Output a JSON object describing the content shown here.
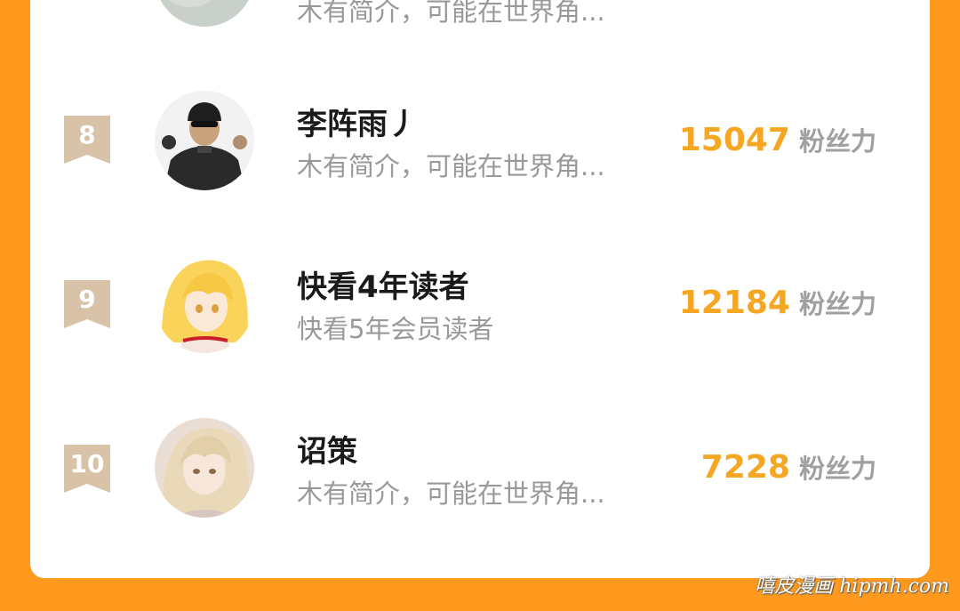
{
  "ranking": {
    "partial_row": {
      "desc": "木有简介，可能在世界角..."
    },
    "rows": [
      {
        "rank": "8",
        "name": "李阵雨丿",
        "desc": "木有简介，可能在世界角...",
        "score": "15047",
        "unit": "粉丝力",
        "avatar_icon": "soldier-avatar-icon"
      },
      {
        "rank": "9",
        "name": "快看4年读者",
        "desc": "快看5年会员读者",
        "score": "12184",
        "unit": "粉丝力",
        "avatar_icon": "anime-girl-blonde-avatar-icon"
      },
      {
        "rank": "10",
        "name": "诏策",
        "desc": "木有简介，可能在世界角...",
        "score": "7228",
        "unit": "粉丝力",
        "avatar_icon": "anime-girl-light-hair-avatar-icon"
      }
    ]
  },
  "watermark": "嘻皮漫画 hipmh.com",
  "colors": {
    "background": "#ff9a1f",
    "card": "#ffffff",
    "score": "#f5a623",
    "badge": "#d9c3a8"
  }
}
